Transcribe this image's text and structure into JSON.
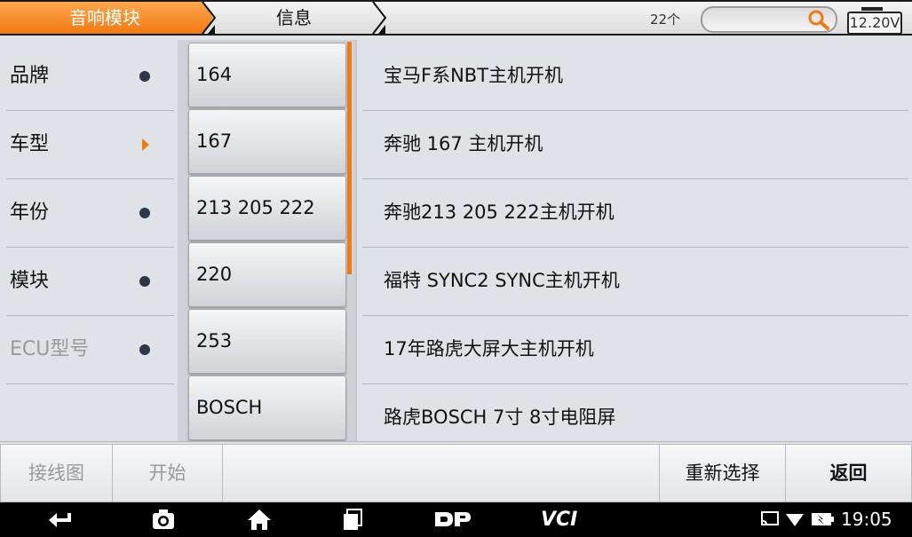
{
  "tabs": {
    "active": "音响模块",
    "info": "信息"
  },
  "status": {
    "count": "22个",
    "voltage": "12.20V"
  },
  "nav": [
    {
      "label": "品牌",
      "indicator": "dot"
    },
    {
      "label": "车型",
      "indicator": "arrow"
    },
    {
      "label": "年份",
      "indicator": "dot"
    },
    {
      "label": "模块",
      "indicator": "dot"
    },
    {
      "label": "ECU型号",
      "indicator": "dot"
    }
  ],
  "models": [
    "164",
    "167",
    "213 205 222",
    "220",
    "253",
    "BOSCH"
  ],
  "items": [
    "宝马F系NBT主机开机",
    "奔驰 167 主机开机",
    "奔驰213 205 222主机开机",
    "福特 SYNC2 SYNC主机开机",
    "17年路虎大屏大主机开机",
    "路虎BOSCH 7寸 8寸电阻屏"
  ],
  "actions": {
    "wiring": "接线图",
    "start": "开始",
    "reselect": "重新选择",
    "back": "返回"
  },
  "system": {
    "time": "19:05",
    "vci": "VCI"
  },
  "colors": {
    "accent": "#f07a12",
    "indicator_dot": "#2c3747"
  }
}
